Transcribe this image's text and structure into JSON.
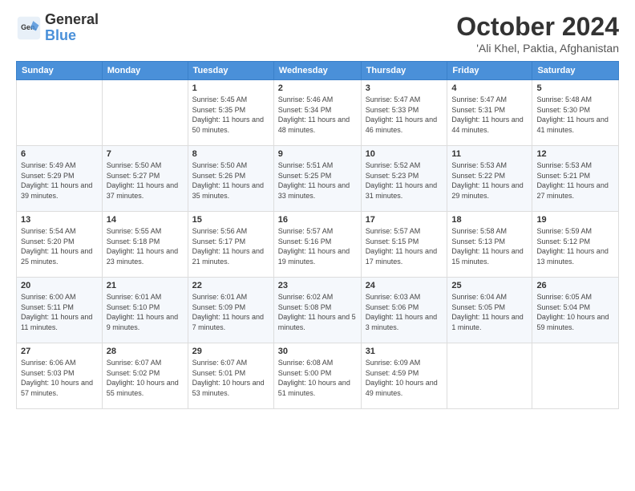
{
  "logo": {
    "line1": "General",
    "line2": "Blue"
  },
  "title": "October 2024",
  "location": "'Ali Khel, Paktia, Afghanistan",
  "days_of_week": [
    "Sunday",
    "Monday",
    "Tuesday",
    "Wednesday",
    "Thursday",
    "Friday",
    "Saturday"
  ],
  "weeks": [
    [
      {
        "day": "",
        "info": ""
      },
      {
        "day": "",
        "info": ""
      },
      {
        "day": "1",
        "info": "Sunrise: 5:45 AM\nSunset: 5:35 PM\nDaylight: 11 hours and 50 minutes."
      },
      {
        "day": "2",
        "info": "Sunrise: 5:46 AM\nSunset: 5:34 PM\nDaylight: 11 hours and 48 minutes."
      },
      {
        "day": "3",
        "info": "Sunrise: 5:47 AM\nSunset: 5:33 PM\nDaylight: 11 hours and 46 minutes."
      },
      {
        "day": "4",
        "info": "Sunrise: 5:47 AM\nSunset: 5:31 PM\nDaylight: 11 hours and 44 minutes."
      },
      {
        "day": "5",
        "info": "Sunrise: 5:48 AM\nSunset: 5:30 PM\nDaylight: 11 hours and 41 minutes."
      }
    ],
    [
      {
        "day": "6",
        "info": "Sunrise: 5:49 AM\nSunset: 5:29 PM\nDaylight: 11 hours and 39 minutes."
      },
      {
        "day": "7",
        "info": "Sunrise: 5:50 AM\nSunset: 5:27 PM\nDaylight: 11 hours and 37 minutes."
      },
      {
        "day": "8",
        "info": "Sunrise: 5:50 AM\nSunset: 5:26 PM\nDaylight: 11 hours and 35 minutes."
      },
      {
        "day": "9",
        "info": "Sunrise: 5:51 AM\nSunset: 5:25 PM\nDaylight: 11 hours and 33 minutes."
      },
      {
        "day": "10",
        "info": "Sunrise: 5:52 AM\nSunset: 5:23 PM\nDaylight: 11 hours and 31 minutes."
      },
      {
        "day": "11",
        "info": "Sunrise: 5:53 AM\nSunset: 5:22 PM\nDaylight: 11 hours and 29 minutes."
      },
      {
        "day": "12",
        "info": "Sunrise: 5:53 AM\nSunset: 5:21 PM\nDaylight: 11 hours and 27 minutes."
      }
    ],
    [
      {
        "day": "13",
        "info": "Sunrise: 5:54 AM\nSunset: 5:20 PM\nDaylight: 11 hours and 25 minutes."
      },
      {
        "day": "14",
        "info": "Sunrise: 5:55 AM\nSunset: 5:18 PM\nDaylight: 11 hours and 23 minutes."
      },
      {
        "day": "15",
        "info": "Sunrise: 5:56 AM\nSunset: 5:17 PM\nDaylight: 11 hours and 21 minutes."
      },
      {
        "day": "16",
        "info": "Sunrise: 5:57 AM\nSunset: 5:16 PM\nDaylight: 11 hours and 19 minutes."
      },
      {
        "day": "17",
        "info": "Sunrise: 5:57 AM\nSunset: 5:15 PM\nDaylight: 11 hours and 17 minutes."
      },
      {
        "day": "18",
        "info": "Sunrise: 5:58 AM\nSunset: 5:13 PM\nDaylight: 11 hours and 15 minutes."
      },
      {
        "day": "19",
        "info": "Sunrise: 5:59 AM\nSunset: 5:12 PM\nDaylight: 11 hours and 13 minutes."
      }
    ],
    [
      {
        "day": "20",
        "info": "Sunrise: 6:00 AM\nSunset: 5:11 PM\nDaylight: 11 hours and 11 minutes."
      },
      {
        "day": "21",
        "info": "Sunrise: 6:01 AM\nSunset: 5:10 PM\nDaylight: 11 hours and 9 minutes."
      },
      {
        "day": "22",
        "info": "Sunrise: 6:01 AM\nSunset: 5:09 PM\nDaylight: 11 hours and 7 minutes."
      },
      {
        "day": "23",
        "info": "Sunrise: 6:02 AM\nSunset: 5:08 PM\nDaylight: 11 hours and 5 minutes."
      },
      {
        "day": "24",
        "info": "Sunrise: 6:03 AM\nSunset: 5:06 PM\nDaylight: 11 hours and 3 minutes."
      },
      {
        "day": "25",
        "info": "Sunrise: 6:04 AM\nSunset: 5:05 PM\nDaylight: 11 hours and 1 minute."
      },
      {
        "day": "26",
        "info": "Sunrise: 6:05 AM\nSunset: 5:04 PM\nDaylight: 10 hours and 59 minutes."
      }
    ],
    [
      {
        "day": "27",
        "info": "Sunrise: 6:06 AM\nSunset: 5:03 PM\nDaylight: 10 hours and 57 minutes."
      },
      {
        "day": "28",
        "info": "Sunrise: 6:07 AM\nSunset: 5:02 PM\nDaylight: 10 hours and 55 minutes."
      },
      {
        "day": "29",
        "info": "Sunrise: 6:07 AM\nSunset: 5:01 PM\nDaylight: 10 hours and 53 minutes."
      },
      {
        "day": "30",
        "info": "Sunrise: 6:08 AM\nSunset: 5:00 PM\nDaylight: 10 hours and 51 minutes."
      },
      {
        "day": "31",
        "info": "Sunrise: 6:09 AM\nSunset: 4:59 PM\nDaylight: 10 hours and 49 minutes."
      },
      {
        "day": "",
        "info": ""
      },
      {
        "day": "",
        "info": ""
      }
    ]
  ]
}
